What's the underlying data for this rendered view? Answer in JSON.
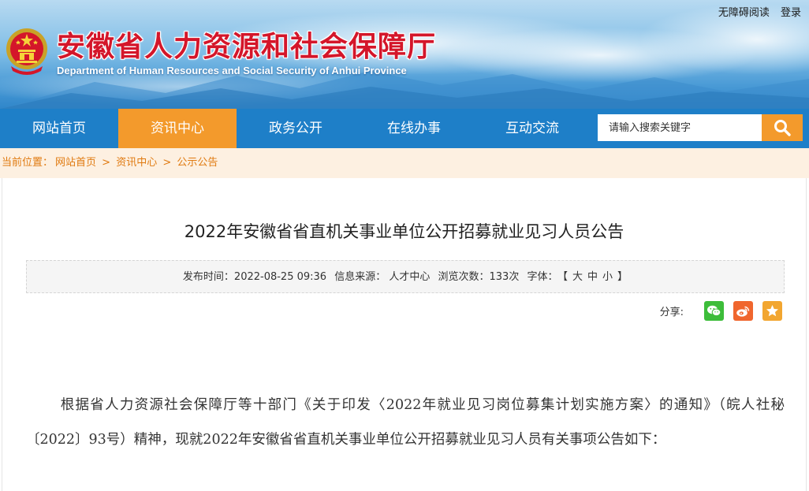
{
  "header": {
    "site_title": "安徽省人力资源和社会保障厅",
    "site_subtitle": "Department of Human Resources and Social Security of Anhui Province",
    "top_links": [
      "无障碍阅读",
      "登录"
    ]
  },
  "nav": {
    "items": [
      "网站首页",
      "资讯中心",
      "政务公开",
      "在线办事",
      "互动交流"
    ],
    "active_index": 1,
    "search_placeholder": "请输入搜索关键字"
  },
  "breadcrumb": {
    "prefix": "当前位置：",
    "items": [
      "网站首页",
      "资讯中心",
      "公示公告"
    ],
    "separator": ">"
  },
  "article": {
    "title": "2022年安徽省省直机关事业单位公开招募就业见习人员公告",
    "meta": {
      "publish_time": "发布时间：2022-08-25 09:36",
      "source": "信息来源：  人才中心",
      "views": "浏览次数：133次",
      "font_label": "字体：",
      "font_open": "【",
      "font_large": "大",
      "font_medium": "中",
      "font_small": "小",
      "font_close": "】"
    },
    "share_label": "分享:",
    "body": "根据省人力资源社会保障厅等十部门《关于印发〈2022年就业见习岗位募集计划实施方案〉的通知》（皖人社秘〔2022〕93号）精神，现就2022年安徽省省直机关事业单位公开招募就业见习人员有关事项公告如下："
  },
  "colors": {
    "nav_bg": "#1e7fc8",
    "accent_orange": "#f39a2c",
    "title_red": "#d4162a",
    "breadcrumb_bg": "#fdf0e1",
    "breadcrumb_text": "#e07a10",
    "wechat_green": "#3dbd3a",
    "weibo_orange": "#f0662e",
    "favorite_yellow": "#f2a630"
  },
  "icons": [
    "national-emblem-icon",
    "search-icon",
    "wechat-icon",
    "weibo-icon",
    "star-icon"
  ]
}
